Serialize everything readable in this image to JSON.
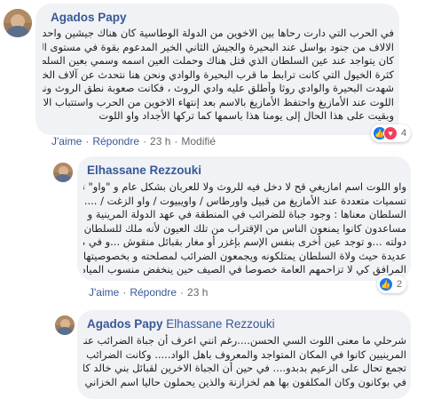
{
  "comments": [
    {
      "author": "Agados Papy",
      "lines": [
        "في الحرب التي دارت رحاها بين الاخوين من الدولة الوطاسية كان هناك جيشين واحد يشمل",
        "الالاف من جنود بواسل عند البحيرة والجيش الثاني الخير المدعوم بقوة في مستوى الفريق الأول",
        "كان يتواجد عند عين السلطان الذي قتل هناك وحملت العين اسمه وسمي بعين السلطان ، ومن",
        "كثرة الخيول التي كانت ترابط ما قرب البحيرة والوادي ونحن هنا نتحدث عن آلاف الخيول",
        "شهدت البحيرة والوادي روثا وأطلق عليه وادي الروث ، فكانت صعوبة نطق الروث ونطقت بواو",
        "اللوت عند الأمازيغ واحتفظ الأمازيغ بالاسم بعد إنتهاء الاخوين من الحرب واستتباب الامن...",
        "وبقيت على هذا الحال إلى يومنا هذا باسمها كما تركها الأجداد واو اللوت"
      ],
      "actions": {
        "like": "J'aime",
        "reply": "Répondre",
        "time": "23 h",
        "modified": "Modifié"
      },
      "reactions": {
        "count": "4"
      }
    },
    {
      "author": "Elhassane Rezzouki",
      "lines": [
        "واو اللوت اسم امازيغي قح لا دخل فيه للروث ولا للعربان بشكل عام و \"واو\" تتكرر في",
        "تسميات متعددة عند الأمازيغ من قبيل واورطاس / واويبيوت / واو الزغت / ......عين",
        "السلطان معناها : وجود جباة للضرائب في المنطقة في عهد الدولة المرينية و له",
        "مساعدون كانوا يمنعون الناس من الإقتراب من تلك العيون لأنه ملك للسلطان و لخدّام",
        "دولته ...و توجد عين أخرى بنفس الإسم بإغزر أو مغار بقبائل منقوش ...و في مناطق",
        "عديدة حيث ولاة السلطان يمتلكونه ويجمعون الضرائب لمصلحته و بخصوصيتها بعض",
        "المرافق كي لا تزاحمهم العامة خصوصا في الصيف حين ينخفض منسوب المياه ..."
      ],
      "actions": {
        "like": "J'aime",
        "reply": "Répondre",
        "time": "23 h"
      },
      "reactions": {
        "count": "2"
      }
    },
    {
      "author": "Agados Papy",
      "mention": "Elhassane Rezzouki",
      "lines": [
        "شرحلي ما معنى اللوت السي الحسن....رغم انني اعرف أن جباة الضرائب عند",
        "المرينيين كانوا في المكان المتواجد والمعروف باهل الواد..... وكانت الضرائب التي",
        "تجمع تحال على الزعيم بدبدو.... في حين أن الجباة الاخرين لقبائل بني خالد كانت تجمع",
        "في بوكانون وكان المكلفون بها هم لخزازنة والذين يحملون حاليا اسم الخزاني"
      ]
    }
  ]
}
